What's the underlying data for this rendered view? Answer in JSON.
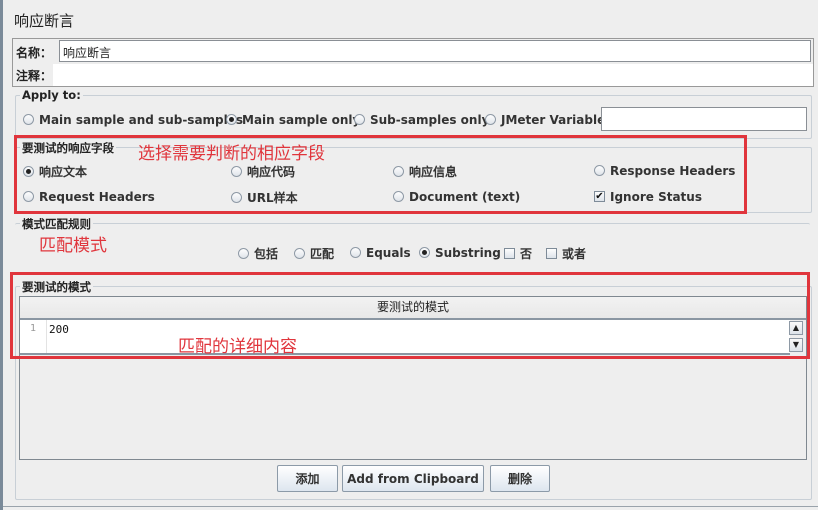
{
  "panel": {
    "title": "响应断言",
    "name_label": "名称：",
    "name_value": "响应断言",
    "comment_label": "注释：",
    "comment_value": ""
  },
  "apply_to": {
    "legend": "Apply to:",
    "options": [
      {
        "label": "Main sample and sub-samples",
        "selected": false
      },
      {
        "label": "Main sample only",
        "selected": true
      },
      {
        "label": "Sub-samples only",
        "selected": false
      },
      {
        "label": "JMeter Variable",
        "selected": false
      }
    ],
    "variable_value": ""
  },
  "response_field": {
    "legend": "要测试的响应字段",
    "options": [
      {
        "label": "响应文本",
        "selected": true
      },
      {
        "label": "响应代码",
        "selected": false
      },
      {
        "label": "响应信息",
        "selected": false
      },
      {
        "label": "Response Headers",
        "selected": false
      },
      {
        "label": "Request Headers",
        "selected": false
      },
      {
        "label": "URL样本",
        "selected": false
      },
      {
        "label": "Document (text)",
        "selected": false
      }
    ],
    "ignore_status": {
      "label": "Ignore Status",
      "checked": true
    }
  },
  "pattern_rules": {
    "legend": "模式匹配规则",
    "options": [
      {
        "label": "包括",
        "selected": false
      },
      {
        "label": "匹配",
        "selected": false
      },
      {
        "label": "Equals",
        "selected": false
      },
      {
        "label": "Substring",
        "selected": true
      }
    ],
    "not": {
      "label": "否",
      "checked": false
    },
    "or": {
      "label": "或者",
      "checked": false
    }
  },
  "patterns": {
    "legend": "要测试的模式",
    "column_header": "要测试的模式",
    "rows": [
      {
        "line": "1",
        "value": "200"
      }
    ]
  },
  "buttons": {
    "add": "添加",
    "add_clipboard": "Add from Clipboard",
    "delete": "删除"
  },
  "annotations": {
    "field_note": "选择需要判断的相应字段",
    "match_note": "匹配模式",
    "content_note": "匹配的详细内容",
    "color": "#e0353c"
  }
}
